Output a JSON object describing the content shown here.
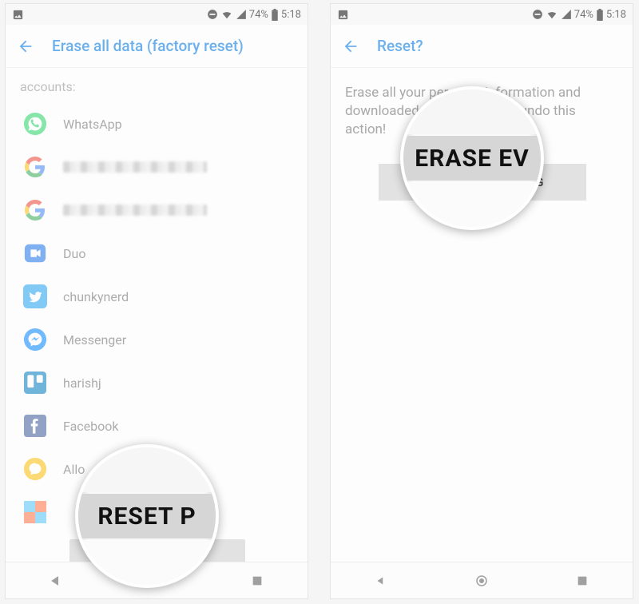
{
  "statusbar": {
    "battery_pct": "74%",
    "time": "5:18"
  },
  "left": {
    "title": "Erase all data (factory reset)",
    "section_label": "accounts:",
    "accounts": [
      {
        "icon": "whatsapp",
        "label": "WhatsApp"
      },
      {
        "icon": "google",
        "label": "",
        "redacted": true
      },
      {
        "icon": "google",
        "label": "",
        "redacted": true
      },
      {
        "icon": "duo",
        "label": "Duo"
      },
      {
        "icon": "twitter",
        "label": "chunkynerd"
      },
      {
        "icon": "messenger",
        "label": "Messenger"
      },
      {
        "icon": "trello",
        "label": "harishj"
      },
      {
        "icon": "facebook",
        "label": "Facebook"
      },
      {
        "icon": "allo",
        "label": "Allo"
      },
      {
        "icon": "squares",
        "label": ""
      }
    ],
    "button_label": "RESET PHONE",
    "mag_text": "RESET P"
  },
  "right": {
    "title": "Reset?",
    "body_text": "Erase all your personal information and downloaded apps? You can't undo this action!",
    "button_label": "ERASE EVERYTHING",
    "mag_text": "ERASE EV"
  }
}
